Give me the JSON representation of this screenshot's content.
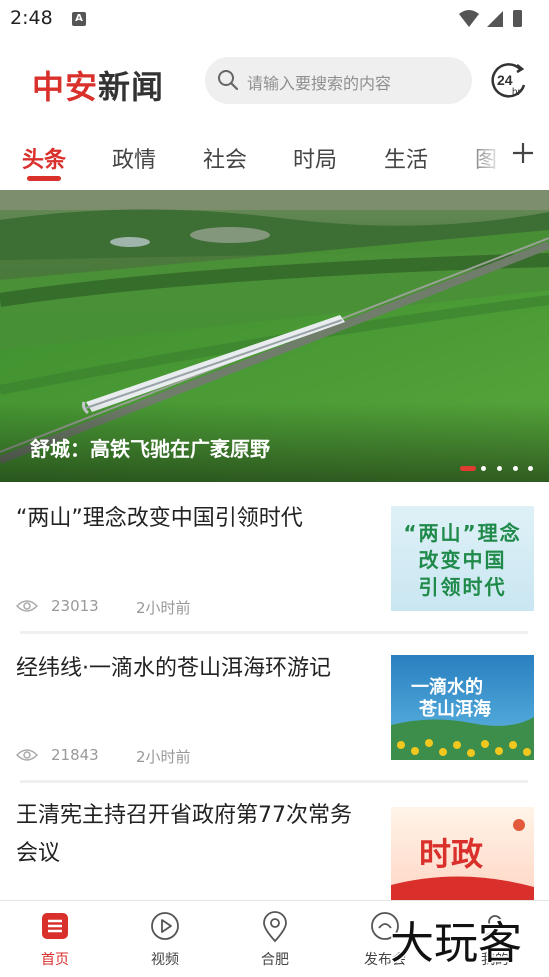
{
  "status_bar": {
    "time": "2:48",
    "notification_icon": "A"
  },
  "header": {
    "logo_red": "中安",
    "logo_dark": "新闻",
    "search_placeholder": "请输入要搜索的内容",
    "hr24_number": "24",
    "hr24_unit": "hr"
  },
  "tabs": [
    {
      "label": "头条",
      "active": true
    },
    {
      "label": "政情",
      "active": false
    },
    {
      "label": "社会",
      "active": false
    },
    {
      "label": "时局",
      "active": false
    },
    {
      "label": "生活",
      "active": false
    },
    {
      "label": "图",
      "active": false
    }
  ],
  "banner": {
    "caption": "舒城：高铁飞驰在广袤原野",
    "dot_count": 5,
    "active_dot": 0
  },
  "news": [
    {
      "title": "“两山”理念改变中国引领时代",
      "views": "23013",
      "time": "2小时前",
      "thumb_text": "“两山”理念\n改变中国\n引领时代"
    },
    {
      "title": "经纬线·一滴水的苍山洱海环游记",
      "views": "21843",
      "time": "2小时前",
      "thumb_text": "一滴水的\n苍山洱海"
    },
    {
      "title": "王清宪主持召开省政府第77次常务会议",
      "thumb_text": "时政"
    }
  ],
  "bottom_nav": [
    {
      "label": "首页",
      "icon": "home-icon",
      "active": true
    },
    {
      "label": "视频",
      "icon": "play-icon",
      "active": false
    },
    {
      "label": "合肥",
      "icon": "location-icon",
      "active": false
    },
    {
      "label": "发布会",
      "icon": "press-icon",
      "active": false
    },
    {
      "label": "我的",
      "icon": "profile-icon",
      "active": false
    }
  ],
  "watermark": "大玩客",
  "colors": {
    "accent": "#d9302c",
    "text": "#222222",
    "muted": "#999999"
  }
}
